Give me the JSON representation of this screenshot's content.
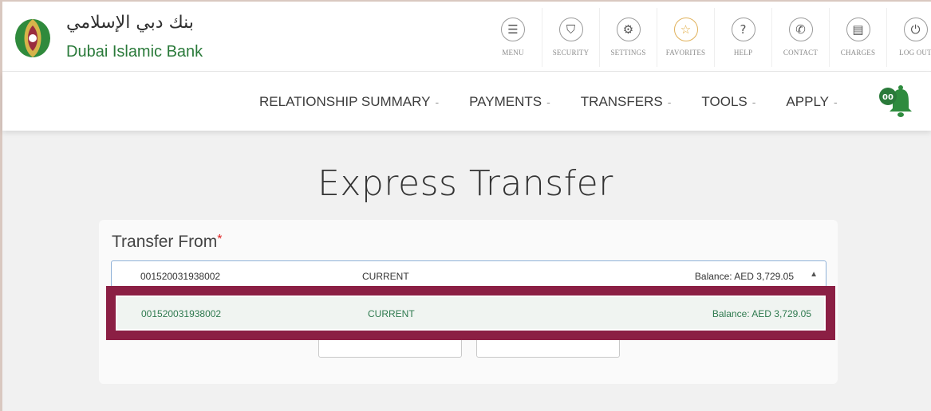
{
  "brand": {
    "name_ar": "بنك دبي الإسلامي",
    "name_en": "Dubai Islamic Bank"
  },
  "toolbar": [
    {
      "label": "MENU",
      "icon": "menu-icon",
      "glyph": "☰"
    },
    {
      "label": "SECURITY",
      "icon": "shield-icon",
      "glyph": "⛉"
    },
    {
      "label": "SETTINGS",
      "icon": "gear-icon",
      "glyph": "⚙"
    },
    {
      "label": "FAVORITES",
      "icon": "star-icon",
      "glyph": "☆"
    },
    {
      "label": "HELP",
      "icon": "help-icon",
      "glyph": "?"
    },
    {
      "label": "CONTACT",
      "icon": "phone-icon",
      "glyph": "✆"
    },
    {
      "label": "CHARGES",
      "icon": "charges-icon",
      "glyph": "▤"
    },
    {
      "label": "LOG OUT",
      "icon": "power-icon",
      "glyph": "⏻"
    }
  ],
  "nav": [
    {
      "label": "RELATIONSHIP SUMMARY"
    },
    {
      "label": "PAYMENTS"
    },
    {
      "label": "TRANSFERS"
    },
    {
      "label": "TOOLS"
    },
    {
      "label": "APPLY"
    }
  ],
  "nav_caret": "-",
  "notification": {
    "badge": "00"
  },
  "page": {
    "title": "Express Transfer"
  },
  "transfer_from": {
    "label": "Transfer From",
    "required_mark": "*",
    "selected": {
      "account": "001520031938002",
      "type": "CURRENT",
      "balance": "Balance: AED 3,729.05"
    },
    "options": [
      {
        "account": "001520031938002",
        "type": "CURRENT",
        "balance": "Balance: AED 3,729.05"
      }
    ]
  },
  "colors": {
    "brand_green": "#2a7a3a",
    "highlight_border": "#8b1f44",
    "required": "#e02020",
    "favorites_gold": "#e0a83a"
  }
}
